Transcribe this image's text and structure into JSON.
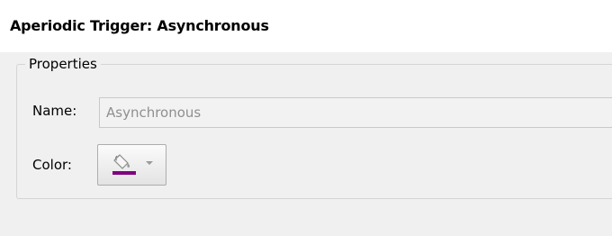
{
  "title": "Aperiodic Trigger: Asynchronous",
  "properties": {
    "group_label": "Properties",
    "name_label": "Name:",
    "name_value": "Asynchronous",
    "color_label": "Color:",
    "color_value": "#800080",
    "color_button_icon": "paint-bucket-icon",
    "color_dropdown_icon": "dropdown-arrow-icon"
  }
}
